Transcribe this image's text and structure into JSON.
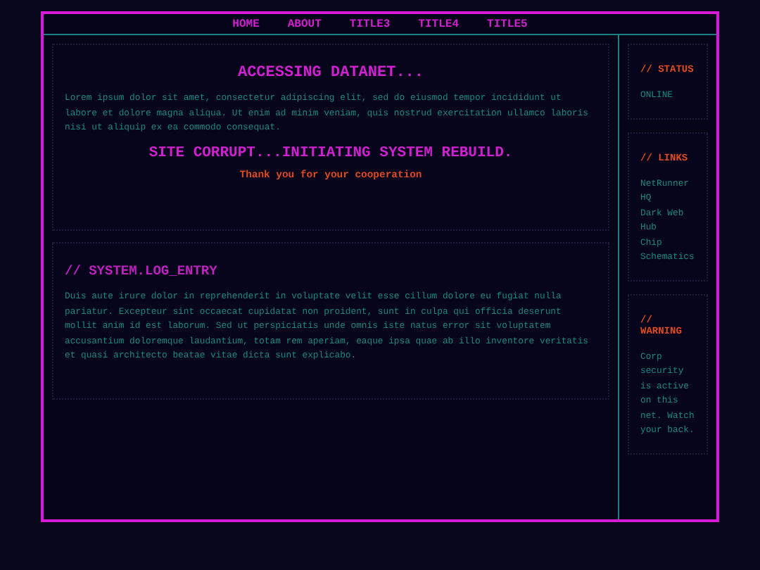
{
  "nav": {
    "items": [
      {
        "label": "HOME"
      },
      {
        "label": "ABOUT"
      },
      {
        "label": "TITLE3"
      },
      {
        "label": "TITLE4"
      },
      {
        "label": "TITLE5"
      }
    ]
  },
  "hero": {
    "title": "ACCESSING DATANET...",
    "body": "Lorem ipsum dolor sit amet, consectetur adipiscing elit, sed do eiusmod tempor incididunt ut labore et dolore magna aliqua. Ut enim ad minim veniam, quis nostrud exercitation ullamco laboris nisi ut aliquip ex ea commodo consequat.",
    "alert": "SITE CORRUPT...INITIATING SYSTEM REBUILD.",
    "note": "Thank you for your cooperation"
  },
  "log": {
    "title": "// SYSTEM.LOG_ENTRY",
    "body": "Duis aute irure dolor in reprehenderit in voluptate velit esse cillum dolore eu fugiat nulla pariatur. Excepteur sint occaecat cupidatat non proident, sunt in culpa qui officia deserunt mollit anim id est laborum. Sed ut perspiciatis unde omnis iste natus error sit voluptatem accusantium doloremque laudantium, totam rem aperiam, eaque ipsa quae ab illo inventore veritatis et quasi architecto beatae vitae dicta sunt explicabo."
  },
  "sidebar": [
    {
      "kind": "text",
      "title": "// STATUS",
      "text": "ONLINE"
    },
    {
      "kind": "links",
      "title": "// LINKS",
      "links": [
        "NetRunner HQ",
        "Dark Web Hub",
        "Chip Schematics"
      ]
    },
    {
      "kind": "text",
      "title": "// WARNING",
      "text": "Corp security is active on this net. Watch your back."
    }
  ]
}
